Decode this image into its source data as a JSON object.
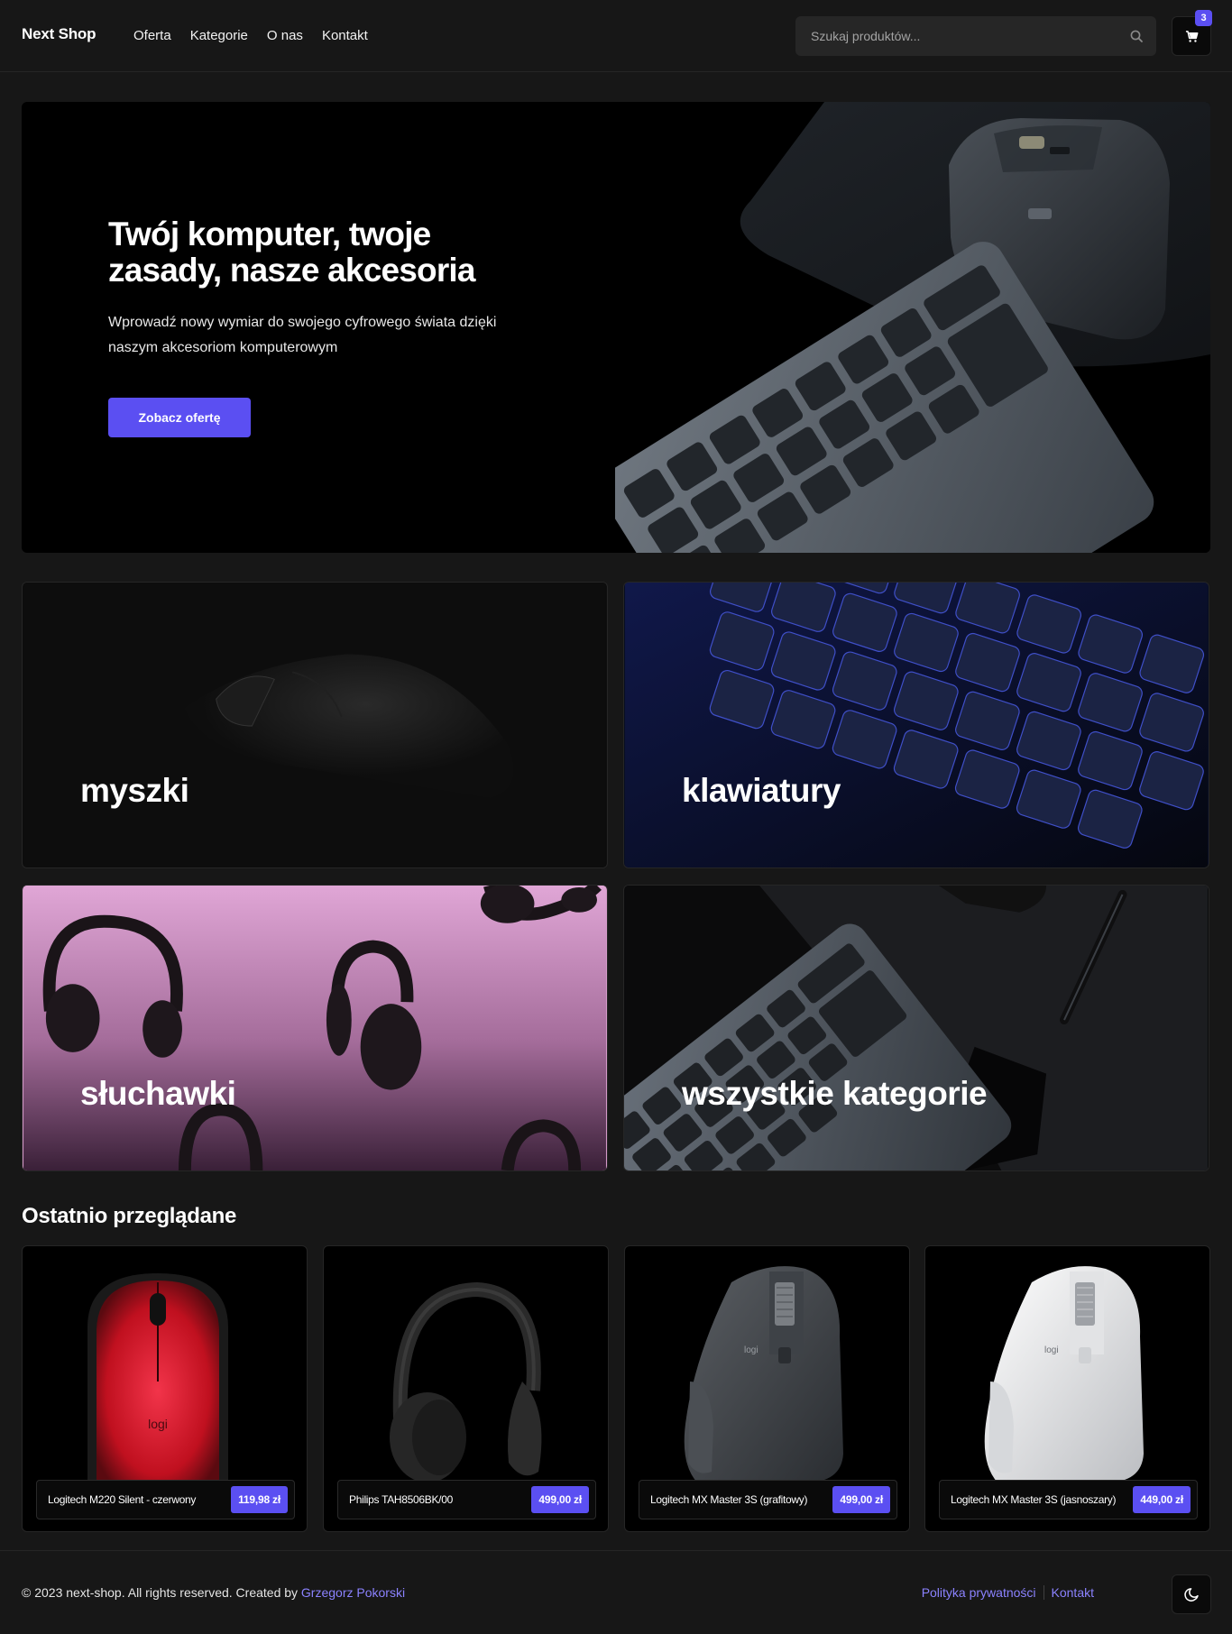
{
  "header": {
    "logo": "Next Shop",
    "nav": [
      "Oferta",
      "Kategorie",
      "O nas",
      "Kontakt"
    ],
    "search_placeholder": "Szukaj produktów...",
    "search_icon": "search-icon",
    "cart_icon": "shopping-cart-icon",
    "cart_count": "3"
  },
  "hero": {
    "title": "Twój komputer, twoje zasady, nasze akcesoria",
    "subtitle": "Wprowadź nowy wymiar do swojego cyfrowego świata dzięki naszym akcesoriom komputerowym",
    "cta": "Zobacz ofertę"
  },
  "categories": [
    {
      "label": "myszki"
    },
    {
      "label": "klawiatury"
    },
    {
      "label": "słuchawki"
    },
    {
      "label": "wszystkie kategorie"
    }
  ],
  "recently_viewed": {
    "title": "Ostatnio przeglądane",
    "products": [
      {
        "name": "Logitech M220 Silent - czerwony",
        "price": "119,98 zł"
      },
      {
        "name": "Philips TAH8506BK/00",
        "price": "499,00 zł"
      },
      {
        "name": "Logitech MX Master 3S (grafitowy)",
        "price": "499,00 zł"
      },
      {
        "name": "Logitech MX Master 3S (jasnoszary)",
        "price": "449,00 zł"
      }
    ]
  },
  "footer": {
    "copyright_prefix": "© 2023 next-shop. All rights reserved. Created by ",
    "author": "Grzegorz Pokorski",
    "links": [
      "Polityka prywatności",
      "Kontakt"
    ],
    "theme_icon": "moon-icon"
  },
  "colors": {
    "background": "#171717",
    "accent": "#5b4ff2",
    "link": "#8b82ff"
  }
}
